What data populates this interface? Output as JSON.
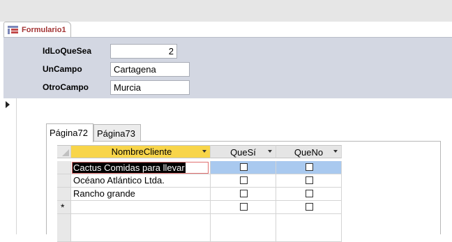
{
  "document_tab": {
    "title": "Formulario1"
  },
  "header": {
    "fields": [
      {
        "label": "IdLoQueSea",
        "value": "2"
      },
      {
        "label": "UnCampo",
        "value": "Cartagena"
      },
      {
        "label": "OtroCampo",
        "value": "Murcia"
      }
    ]
  },
  "tab_control": {
    "tabs": [
      {
        "label": "Página72",
        "active": true
      },
      {
        "label": "Página73",
        "active": false
      }
    ]
  },
  "datasheet": {
    "columns": [
      "NombreCliente",
      "QueSí",
      "QueNo"
    ],
    "rows": [
      {
        "nombre": "Cactus Comidas para llevar",
        "quesi": false,
        "queno": false,
        "current": true
      },
      {
        "nombre": "Océano Atlántico Ltda.",
        "quesi": false,
        "queno": false
      },
      {
        "nombre": "Rancho grande",
        "quesi": false,
        "queno": false
      }
    ],
    "new_row_marker": "*",
    "selected_column_color": "#f8d54a",
    "current_row_color": "#a9c9ef"
  }
}
